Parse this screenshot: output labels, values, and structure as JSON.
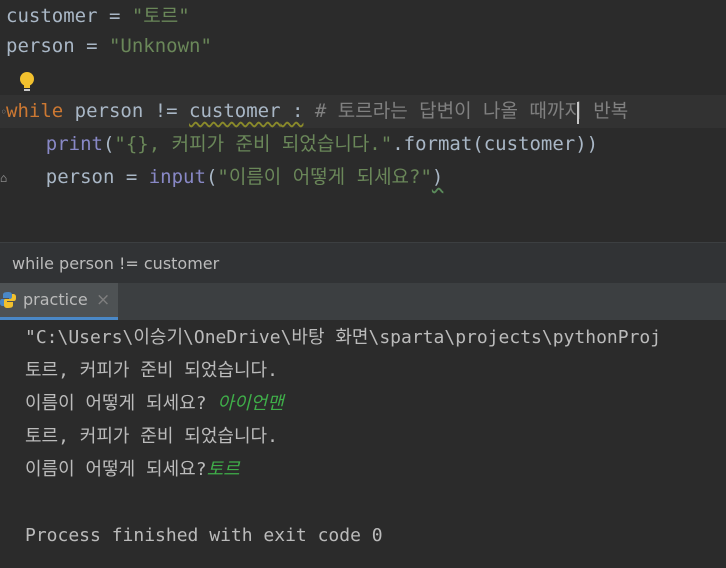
{
  "editor": {
    "line1": {
      "var": "customer",
      "op": " = ",
      "value": "\"토르\""
    },
    "line2": {
      "var": "person",
      "op": " = ",
      "value": "\"Unknown\""
    },
    "line4": {
      "kw": "while",
      "cond_a": " person != ",
      "cond_b": "customer",
      "colon": " :",
      "comment": " # 토르라는 답변이 나올 때까지 반복"
    },
    "line5": {
      "indent": "    ",
      "fn": "print",
      "open": "(",
      "str": "\"{}, 커피가 준비 되었습니다.\"",
      "rest": ".format(customer))"
    },
    "line6": {
      "indent": "    ",
      "var": "person",
      "op": " = ",
      "fn": "input",
      "open": "(",
      "str": "\"이름이 어떻게 되세요?\"",
      "close": ")"
    }
  },
  "breadcrumb": {
    "text": "while person != customer"
  },
  "run_tab": {
    "label": "practice",
    "close": "×"
  },
  "console": {
    "lines": [
      "\"C:\\Users\\이승기\\OneDrive\\바탕 화면\\sparta\\projects\\pythonProj",
      "토르, 커피가 준비 되었습니다.",
      "이름이 어떻게 되세요? ",
      "토르, 커피가 준비 되었습니다.",
      "이름이 어떻게 되세요?",
      "",
      "Process finished with exit code 0"
    ],
    "inputs": [
      "아이언맨",
      "토르"
    ]
  },
  "colors": {
    "keyword": "#cc7832",
    "string": "#6a8759",
    "comment": "#808080",
    "builtin": "#8888c6",
    "input_echo": "#3fae49"
  }
}
